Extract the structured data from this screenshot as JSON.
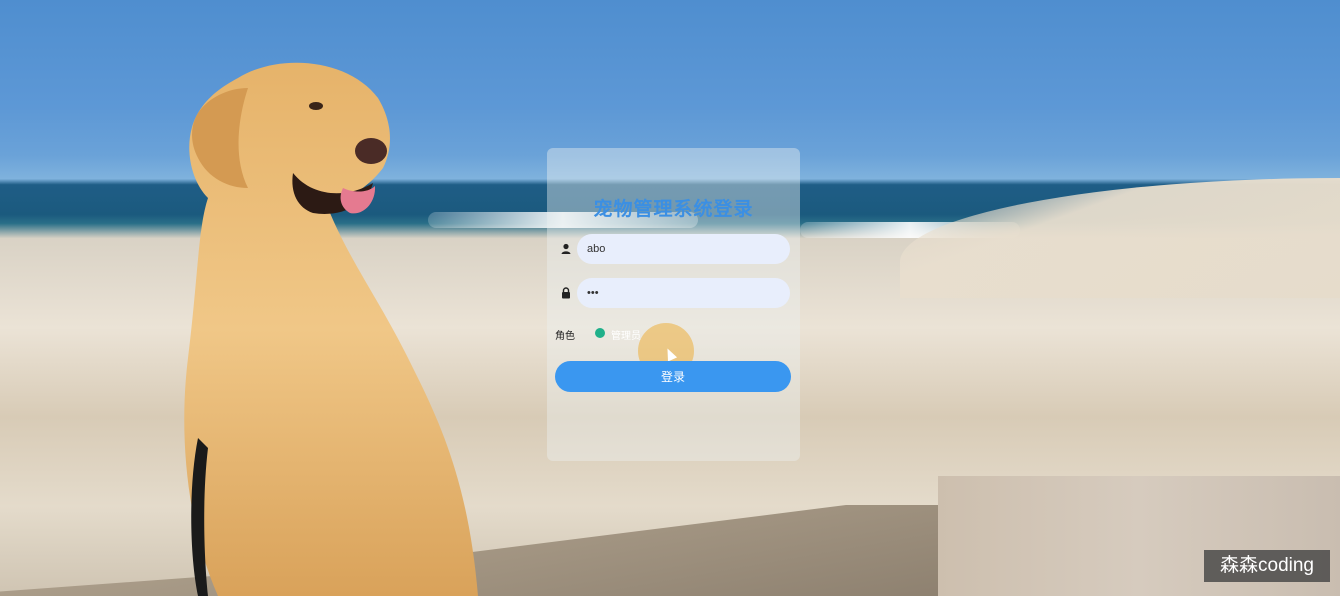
{
  "login": {
    "title": "宠物管理系统登录",
    "username_value": "abo",
    "password_value": "•••",
    "role_label": "角色",
    "role_option": "管理员",
    "submit_label": "登录"
  },
  "icons": {
    "user": "user-icon",
    "lock": "lock-icon",
    "cursor": "mouse-cursor-icon"
  },
  "colors": {
    "accent": "#3a97f0",
    "title": "#3b8fe3",
    "radio": "#1fb08a",
    "input_bg": "#e8eefc"
  },
  "watermark": {
    "text": "森森coding"
  }
}
